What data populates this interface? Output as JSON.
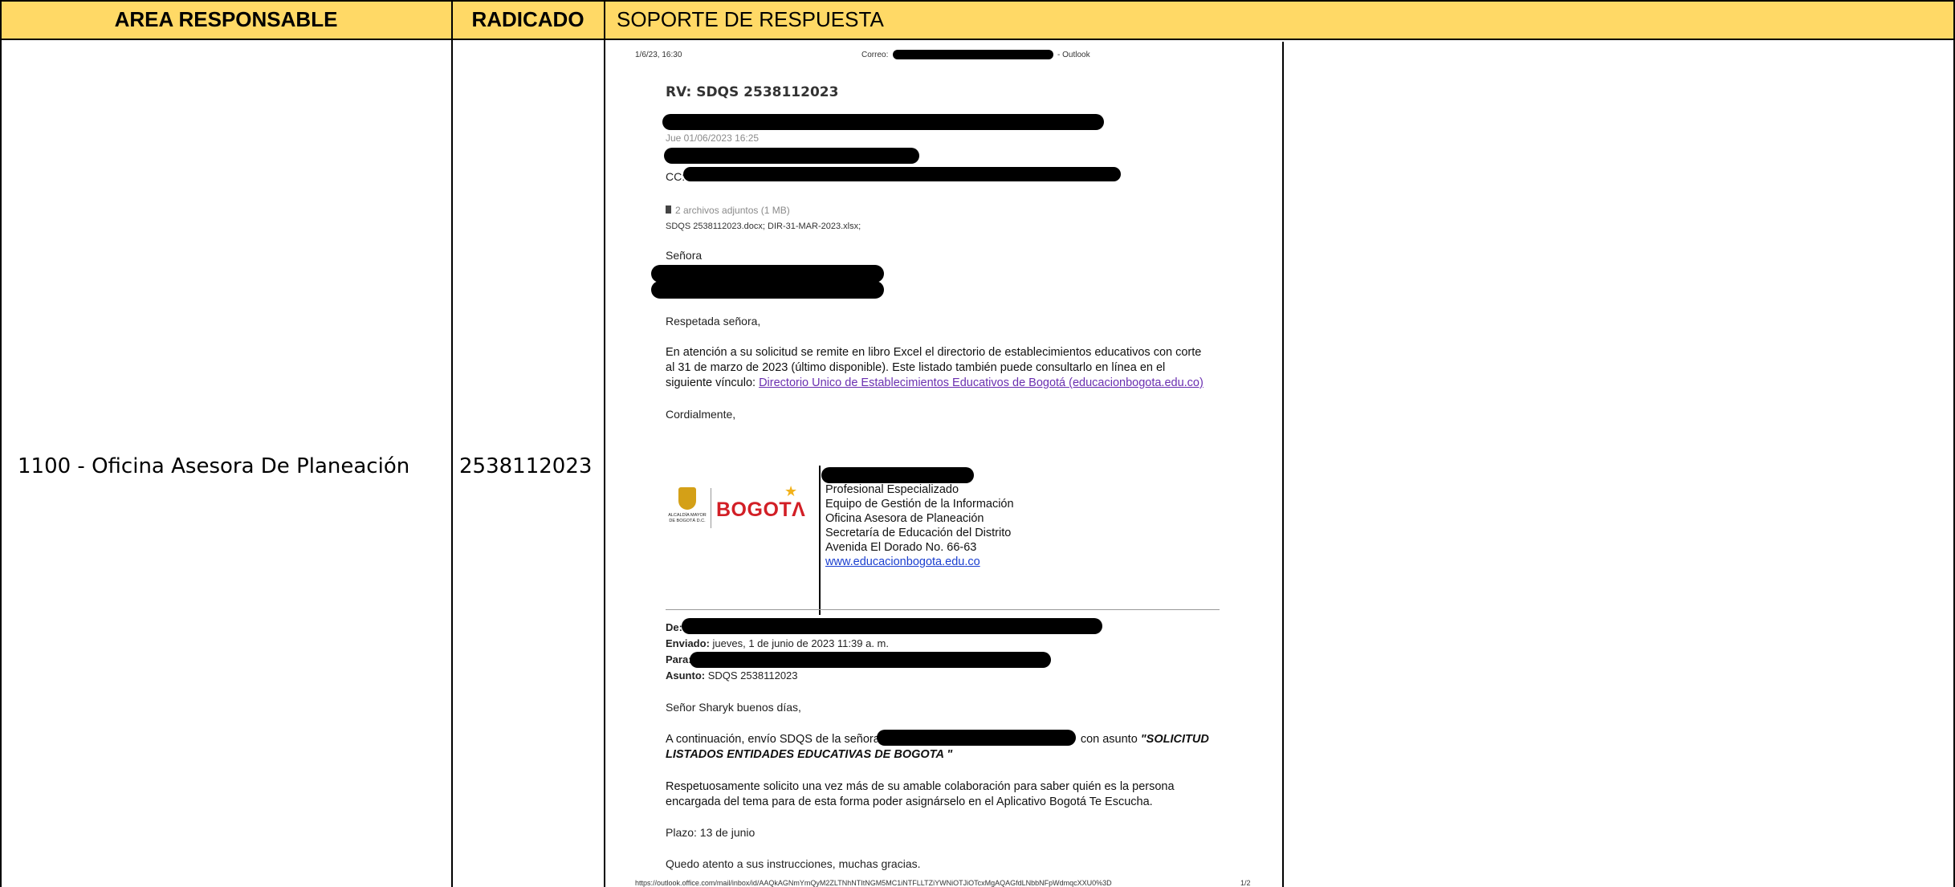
{
  "headers": {
    "area": "AREA RESPONSABLE",
    "radicado": "RADICADO",
    "soporte": "SOPORTE DE RESPUESTA"
  },
  "row": {
    "area": "1100 - Oficina Asesora De Planeación",
    "radicado": "2538112023"
  },
  "document": {
    "print_date": "1/6/23, 16:30",
    "correo_label": "Correo:",
    "outlook_label": "- Outlook",
    "subject": "RV: SDQS 2538112023",
    "sent_date": "Jue 01/06/2023 16:25",
    "cc_label": "CC:",
    "attachments_count": "2 archivos adjuntos (1 MB)",
    "attachments_names": "SDQS 2538112023.docx; DIR-31-MAR-2023.xlsx;",
    "salutation": "Señora",
    "greeting": "Respetada señora,",
    "body_line1": "En atención a su solicitud se remite en libro Excel el directorio de establecimientos educativos con corte",
    "body_line2": "al 31 de marzo de 2023 (último disponible). Este listado también puede consultarlo en línea en el",
    "body_line3_prefix": "siguiente vínculo: ",
    "body_link": "Directorio Unico de Establecimientos Educativos de Bogotá (educacionbogota.edu.co)",
    "closing": "Cordialmente,",
    "logo_alcaldia": "ALCALDÍA MAYOR DE BOGOTÁ D.C.",
    "logo_bogota": "BOGOTΛ",
    "sig_lines": [
      "Profesional Especializado",
      "Equipo de Gestión de la Información",
      "Oficina Asesora de Planeación",
      "Secretaría de Educación del Distrito",
      "Avenida El Dorado No. 66-63"
    ],
    "sig_link": "www.educacionbogota.edu.co",
    "fwd_de": "De:",
    "fwd_enviado_label": "Enviado:",
    "fwd_enviado_value": " jueves, 1 de junio de 2023 11:39 a. m.",
    "fwd_para": "Para:",
    "fwd_asunto_label": "Asunto:",
    "fwd_asunto_value": " SDQS 2538112023",
    "fwd_greeting": "Señor Sharyk buenos días,",
    "fwd_p1_a": "A continuación, envío SDQS de la señora",
    "fwd_p1_b": "con asunto ",
    "fwd_p1_quote1": "\"SOLICITUD",
    "fwd_p1_quote2": "LISTADOS ENTIDADES EDUCATIVAS DE BOGOTA \"",
    "fwd_p2_line1": "Respetuosamente solicito una vez más de su amable colaboración para saber quién es la persona",
    "fwd_p2_line2": "encargada del tema para de esta forma poder asignárselo en el Aplicativo Bogotá Te Escucha.",
    "fwd_plazo": "Plazo: 13 de junio",
    "fwd_closing": "Quedo atento a sus instrucciones, muchas gracias.",
    "footer_url": "https://outlook.office.com/mail/inbox/id/AAQkAGNmYmQyM2ZLTNhNTItNGM5MC1iNTFLLTZiYWNiOTJiOTcxMgAQAGfdLNbbNFpWdmqcXXU0%3D",
    "footer_page": "1/2"
  }
}
